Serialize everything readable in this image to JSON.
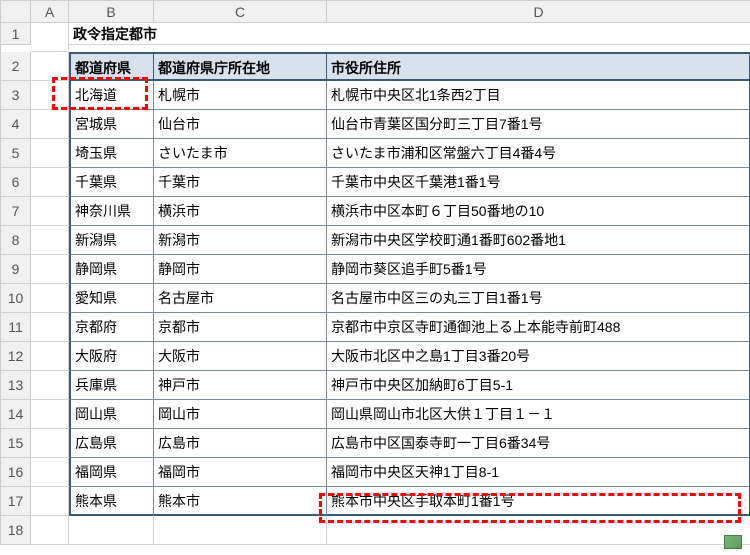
{
  "columns": [
    "A",
    "B",
    "C",
    "D"
  ],
  "rowNumbers": [
    1,
    2,
    3,
    4,
    5,
    6,
    7,
    8,
    9,
    10,
    11,
    12,
    13,
    14,
    15,
    16,
    17,
    18
  ],
  "title": "政令指定都市",
  "headers": {
    "prefecture": "都道府県",
    "capital": "都道府県庁所在地",
    "address": "市役所住所"
  },
  "rows": [
    {
      "prefecture": "北海道",
      "city": "札幌市",
      "address": "札幌市中央区北1条西2丁目"
    },
    {
      "prefecture": "宮城県",
      "city": "仙台市",
      "address": "仙台市青葉区国分町三丁目7番1号"
    },
    {
      "prefecture": "埼玉県",
      "city": "さいたま市",
      "address": "さいたま市浦和区常盤六丁目4番4号"
    },
    {
      "prefecture": "千葉県",
      "city": "千葉市",
      "address": "千葉市中央区千葉港1番1号"
    },
    {
      "prefecture": "神奈川県",
      "city": "横浜市",
      "address": "横浜市中区本町６丁目50番地の10"
    },
    {
      "prefecture": "新潟県",
      "city": "新潟市",
      "address": "新潟市中央区学校町通1番町602番地1"
    },
    {
      "prefecture": "静岡県",
      "city": "静岡市",
      "address": "静岡市葵区追手町5番1号"
    },
    {
      "prefecture": "愛知県",
      "city": "名古屋市",
      "address": "名古屋市中区三の丸三丁目1番1号"
    },
    {
      "prefecture": "京都府",
      "city": "京都市",
      "address": "京都市中京区寺町通御池上る上本能寺前町488"
    },
    {
      "prefecture": "大阪府",
      "city": "大阪市",
      "address": "大阪市北区中之島1丁目3番20号"
    },
    {
      "prefecture": "兵庫県",
      "city": "神戸市",
      "address": "神戸市中央区加納町6丁目5-1"
    },
    {
      "prefecture": "岡山県",
      "city": "岡山市",
      "address": "岡山県岡山市北区大供１丁目１－１"
    },
    {
      "prefecture": "広島県",
      "city": "広島市",
      "address": "広島市中区国泰寺町一丁目6番34号"
    },
    {
      "prefecture": "福岡県",
      "city": "福岡市",
      "address": "福岡市中央区天神1丁目8-1"
    },
    {
      "prefecture": "熊本県",
      "city": "熊本市",
      "address": "熊本市中央区手取本町1番1号"
    }
  ]
}
